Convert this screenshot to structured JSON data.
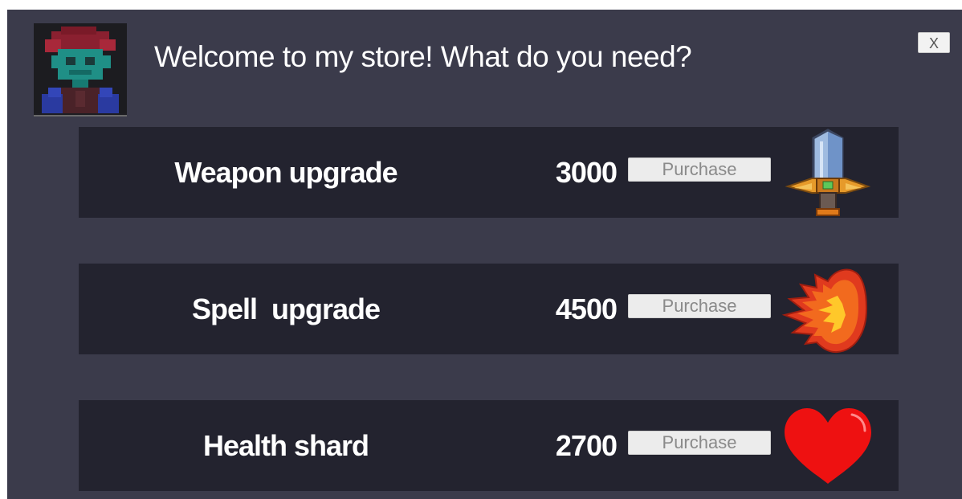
{
  "header": {
    "greeting": "Welcome to my store! What do you need?",
    "close_label": "X",
    "portrait_icon": "shopkeeper-portrait"
  },
  "items": [
    {
      "name": "Weapon upgrade",
      "price": "3000",
      "button_label": "Purchase",
      "icon": "sword-icon"
    },
    {
      "name": "Spell  upgrade",
      "price": "4500",
      "button_label": "Purchase",
      "icon": "fireball-icon"
    },
    {
      "name": "Health shard",
      "price": "2700",
      "button_label": "Purchase",
      "icon": "heart-icon"
    }
  ],
  "colors": {
    "panel_background": "#3b3b4b",
    "row_background": "#23232f",
    "text": "#ffffff",
    "button_background": "#ececec",
    "button_text": "#8a8a8a",
    "heart": "#ee1111",
    "fire": "#e03a1e"
  }
}
